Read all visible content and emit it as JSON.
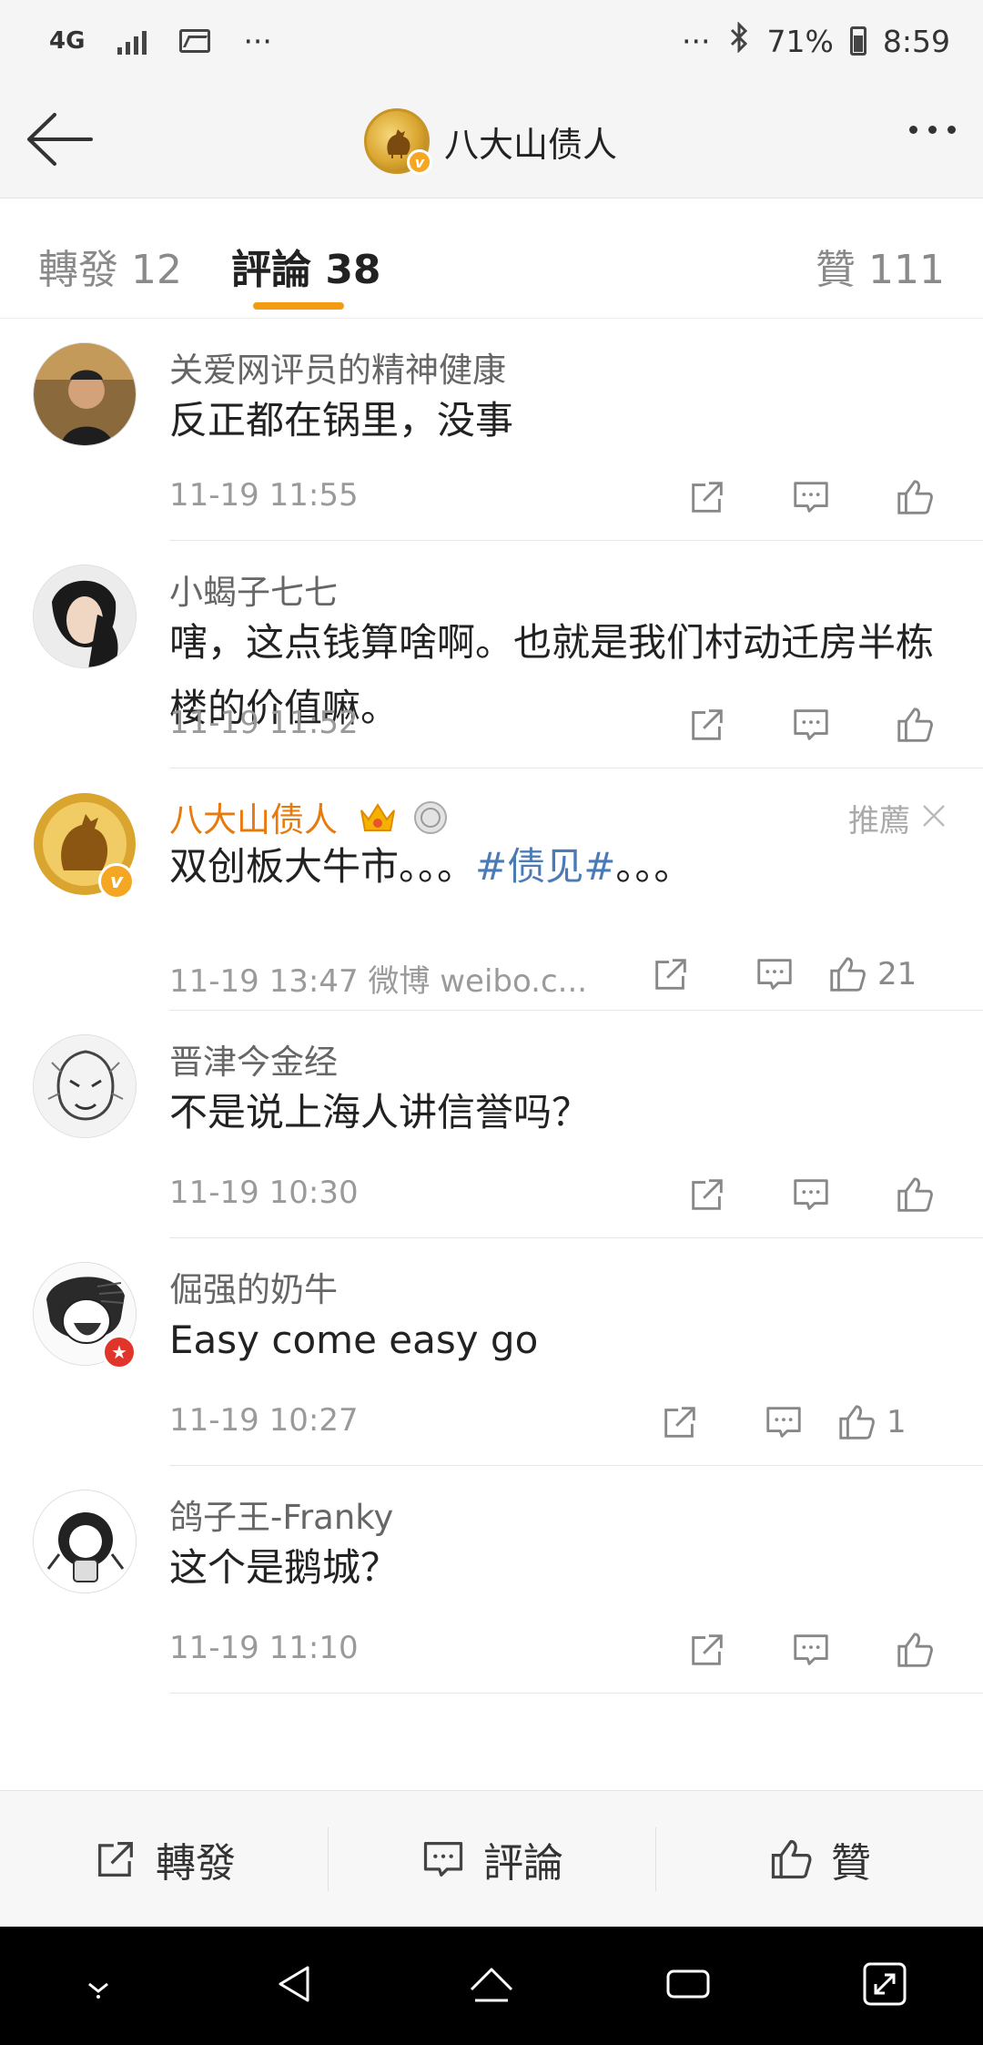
{
  "status_bar": {
    "network": "4G",
    "more_left": "···",
    "more_right": "···",
    "battery": "71%",
    "time": "8:59"
  },
  "header": {
    "title": "八大山债人"
  },
  "tabs": [
    {
      "label": "轉發 12",
      "active": false
    },
    {
      "label": "評論 38",
      "active": true
    },
    {
      "label": "贊 111",
      "active": false
    }
  ],
  "comments": [
    {
      "user": "关爱网评员的精神健康",
      "text": "反正都在锅里，没事",
      "time": "11-19 11:55",
      "likes": ""
    },
    {
      "user": "小蝎子七七",
      "text": "嗐，这点钱算啥啊。也就是我们村动迁房半栋楼的价值嘛。",
      "time": "11-19 11:52",
      "likes": ""
    },
    {
      "user": "八大山债人",
      "text_before": "双创板大牛市。。。",
      "topic": "#债见#",
      "text_after": "。。。",
      "time": "11-19 13:47",
      "source": "微博 weibo.c...",
      "likes": "21",
      "recommend": "推薦"
    },
    {
      "user": "晋津今金经",
      "text": "不是说上海人讲信誉吗？",
      "time": "11-19 10:30",
      "likes": ""
    },
    {
      "user": "倔强的奶牛",
      "text": "Easy come easy go",
      "time": "11-19 10:27",
      "likes": "1"
    },
    {
      "user": "鸽子王-Franky",
      "text": "这个是鹅城？",
      "time": "11-19 11:10",
      "likes": ""
    }
  ],
  "bottom_bar": {
    "repost": "轉發",
    "comment": "評論",
    "like": "贊"
  },
  "colors": {
    "accent": "#f39c12",
    "verified_name": "#e8790c",
    "topic": "#4a7bb7"
  }
}
